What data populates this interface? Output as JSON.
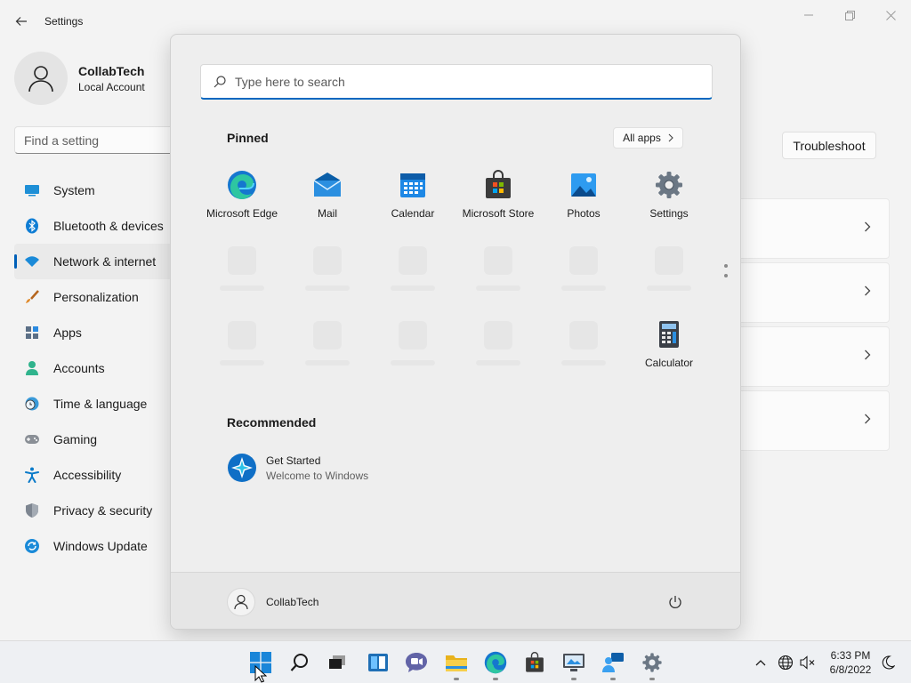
{
  "window": {
    "title": "Settings",
    "controls": [
      "minimize",
      "maximize",
      "close"
    ]
  },
  "profile": {
    "name": "CollabTech",
    "account_type": "Local Account"
  },
  "search_setting": {
    "placeholder": "Find a setting"
  },
  "nav": {
    "active_index": 2,
    "items": [
      {
        "label": "System",
        "icon": "monitor-icon"
      },
      {
        "label": "Bluetooth & devices",
        "icon": "bluetooth-icon"
      },
      {
        "label": "Network & internet",
        "icon": "wifi-icon"
      },
      {
        "label": "Personalization",
        "icon": "brush-icon"
      },
      {
        "label": "Apps",
        "icon": "apps-icon"
      },
      {
        "label": "Accounts",
        "icon": "person-icon"
      },
      {
        "label": "Time & language",
        "icon": "clock-globe-icon"
      },
      {
        "label": "Gaming",
        "icon": "gamepad-icon"
      },
      {
        "label": "Accessibility",
        "icon": "accessibility-icon"
      },
      {
        "label": "Privacy & security",
        "icon": "shield-icon"
      },
      {
        "label": "Windows Update",
        "icon": "update-icon"
      }
    ]
  },
  "main": {
    "troubleshoot_label": "Troubleshoot"
  },
  "start_menu": {
    "search_placeholder": "Type here to search",
    "pinned_title": "Pinned",
    "all_apps_label": "All apps",
    "pinned_apps": [
      {
        "label": "Microsoft Edge",
        "icon": "edge-icon"
      },
      {
        "label": "Mail",
        "icon": "mail-icon"
      },
      {
        "label": "Calendar",
        "icon": "calendar-icon"
      },
      {
        "label": "Microsoft Store",
        "icon": "store-icon"
      },
      {
        "label": "Photos",
        "icon": "photos-icon"
      },
      {
        "label": "Settings",
        "icon": "settings-gear-icon"
      },
      {
        "label": "Calculator",
        "icon": "calculator-icon"
      }
    ],
    "recommended_title": "Recommended",
    "recommended": [
      {
        "title": "Get Started",
        "subtitle": "Welcome to Windows",
        "icon": "get-started-icon"
      }
    ],
    "user_name": "CollabTech"
  },
  "taskbar": {
    "icons": [
      "start-icon",
      "search-icon",
      "task-view-icon",
      "widgets-icon",
      "chat-icon",
      "file-explorer-icon",
      "edge-icon",
      "store-icon",
      "remote-desktop-icon",
      "feedback-hub-icon",
      "settings-gear-icon"
    ],
    "time": "6:33 PM",
    "date": "6/8/2022"
  },
  "colors": {
    "accent": "#005fb8",
    "search_underline": "#0067c0"
  }
}
